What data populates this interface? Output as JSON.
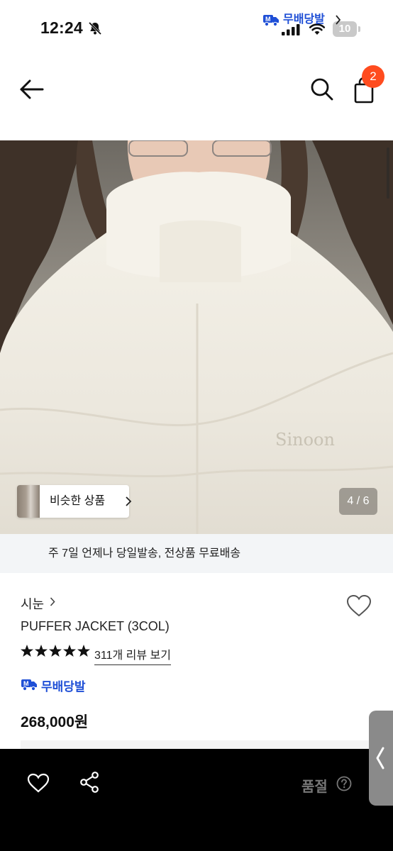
{
  "status_bar": {
    "time": "12:24",
    "battery": "10"
  },
  "header": {
    "cart_count": "2"
  },
  "gallery": {
    "similar_label": "비슷한 상품",
    "pager": "4 / 6",
    "embroidery_text": "Sinoon"
  },
  "delivery_banner": {
    "text": "주 7일 언제나 당일발송, 전상품 무료배송",
    "brand": "무배당발"
  },
  "product": {
    "brand": "시눈",
    "name": "PUFFER JACKET (3COL)",
    "rating_stars": 5,
    "review_link": "311개 리뷰 보기",
    "free_shipping_label": "무배당발",
    "price": "268,000원"
  },
  "bottom_bar": {
    "purchase_status": "품절"
  },
  "colors": {
    "accent": "#ff4c1f",
    "brand_blue": "#1f4fd6"
  },
  "icons": [
    "bell-off-icon",
    "signal-icon",
    "wifi-icon",
    "battery-icon",
    "arrow-left-icon",
    "search-icon",
    "shopping-bag-icon",
    "chevron-right-icon",
    "truck-icon",
    "heart-icon",
    "star-icon",
    "share-icon",
    "question-circle-icon",
    "chevron-left-icon"
  ]
}
